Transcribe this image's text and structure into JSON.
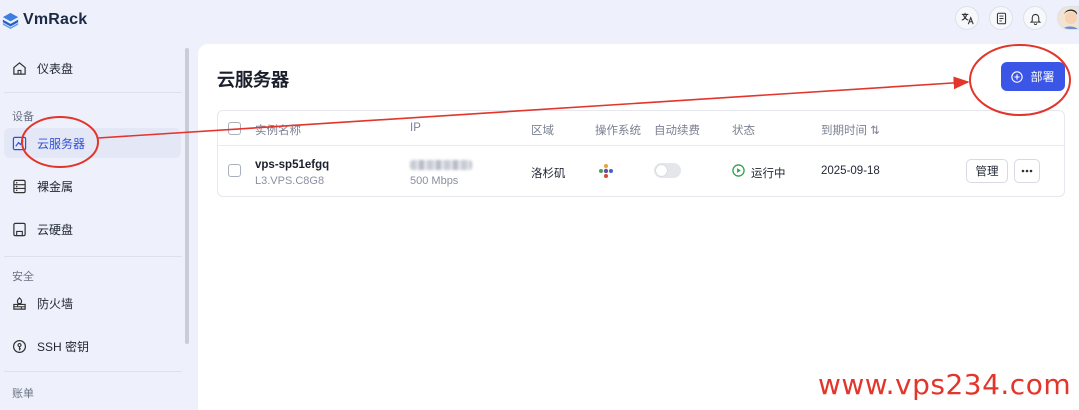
{
  "app": {
    "name": "VmRack"
  },
  "colors": {
    "accent": "#3b55e6",
    "annotation": "#e2352b",
    "running": "#2fa24b"
  },
  "topbar": {
    "icons": [
      "translate-icon",
      "document-icon",
      "bell-icon",
      "avatar"
    ]
  },
  "sidebar": {
    "items": [
      {
        "label": "仪表盘",
        "icon": "home-icon"
      },
      {
        "label": "云服务器",
        "icon": "chart-icon",
        "active": true
      },
      {
        "label": "裸金属",
        "icon": "server-icon"
      },
      {
        "label": "云硬盘",
        "icon": "disk-icon"
      },
      {
        "label": "防火墙",
        "icon": "firewall-icon"
      },
      {
        "label": "SSH 密钥",
        "icon": "key-icon"
      }
    ],
    "sections": {
      "devices": "设备",
      "security": "安全",
      "billing": "账单"
    }
  },
  "main": {
    "title": "云服务器",
    "deploy_label": "部署"
  },
  "table": {
    "columns": {
      "name": "实例名称",
      "ip": "IP",
      "region": "区域",
      "os": "操作系统",
      "autorenew": "自动续费",
      "status": "状态",
      "expiry": "到期时间 ⇅"
    },
    "rows": [
      {
        "name": "vps-sp51efgq",
        "spec": "L3.VPS.C8G8",
        "bandwidth": "500 Mbps",
        "region": "洛杉矶",
        "autorenew": false,
        "status": "运行中",
        "expiry": "2025-09-18",
        "manage_label": "管理",
        "more_label": "···"
      }
    ]
  },
  "watermark": "www.vps234.com"
}
